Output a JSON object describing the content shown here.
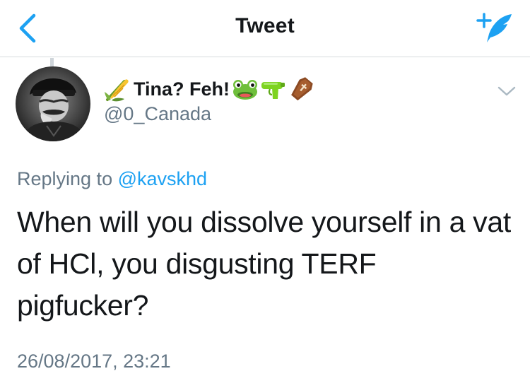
{
  "header": {
    "title": "Tweet",
    "back_icon": "chevron-left-icon",
    "compose_icon": "compose-tweet-icon"
  },
  "tweet": {
    "display_name": "Tina? Feh!",
    "name_emojis_before": [
      "corn-emoji"
    ],
    "name_emojis_after": [
      "frog-face-emoji",
      "water-pistol-emoji",
      "coffin-emoji"
    ],
    "handle": "@0_Canada",
    "replying_prefix": "Replying to",
    "replying_handle": "@kavskhd",
    "text": "When will you dissolve yourself in a vat of HCl, you disgusting TERF pigfucker?",
    "timestamp": "26/08/2017, 23:21",
    "menu_icon": "chevron-down-icon"
  },
  "colors": {
    "accent": "#1da1f2",
    "secondary_text": "#657786",
    "primary_text": "#14171a",
    "divider": "#d6dadd"
  }
}
